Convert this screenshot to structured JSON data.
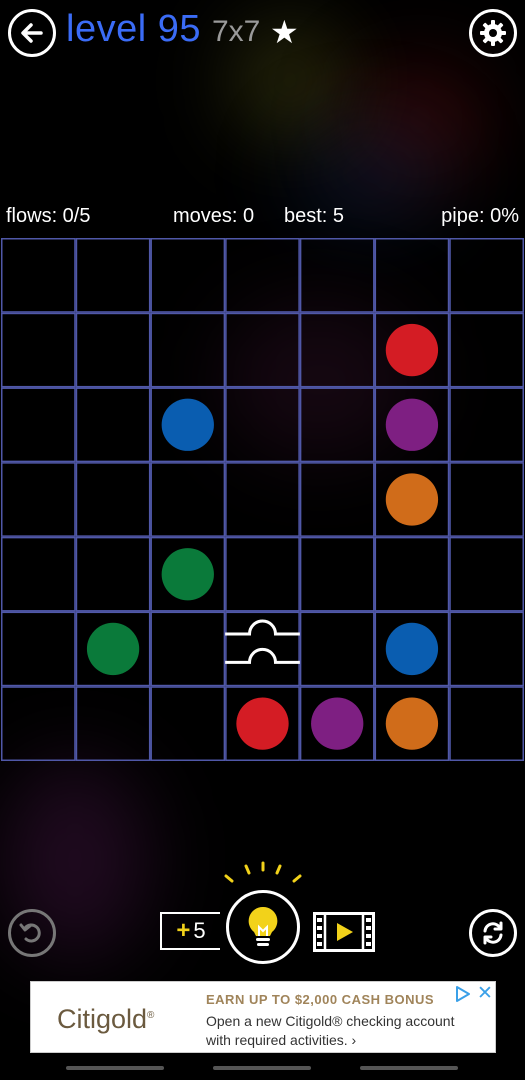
{
  "header": {
    "level_title": "level 95",
    "size_label": "7x7",
    "star": "★"
  },
  "stats": {
    "flows": "flows: 0/5",
    "moves": "moves: 0",
    "best": "best: 5",
    "pipe": "pipe: 0%"
  },
  "board": {
    "rows": 7,
    "cols": 7,
    "grid_color": "#5058a8",
    "dots": [
      {
        "row": 1,
        "col": 5,
        "color": "#d41c24"
      },
      {
        "row": 2,
        "col": 2,
        "color": "#0a5db0"
      },
      {
        "row": 2,
        "col": 5,
        "color": "#7e1f82"
      },
      {
        "row": 3,
        "col": 5,
        "color": "#d06c1a"
      },
      {
        "row": 4,
        "col": 2,
        "color": "#0a7a3a"
      },
      {
        "row": 5,
        "col": 1,
        "color": "#0a7a3a"
      },
      {
        "row": 5,
        "col": 5,
        "color": "#0a5db0"
      },
      {
        "row": 6,
        "col": 3,
        "color": "#d41c24"
      },
      {
        "row": 6,
        "col": 4,
        "color": "#7e1f82"
      },
      {
        "row": 6,
        "col": 5,
        "color": "#d06c1a"
      }
    ],
    "bridges": [
      {
        "row": 5,
        "col": 3
      }
    ]
  },
  "controls": {
    "hints_plus": "+",
    "hints_count": "5"
  },
  "ad": {
    "logo": "Citigold",
    "logo_mark": "®",
    "headline": "EARN UP TO $2,000 CASH BONUS",
    "body": "Open a new Citigold® checking account with required activities. ›",
    "close": "✕"
  },
  "icons": {
    "back": "arrow-left-icon",
    "settings": "gear-icon",
    "undo": "undo-icon",
    "hint": "lightbulb-icon",
    "video": "film-play-icon",
    "reset": "refresh-icon",
    "adchoices": "adchoices-icon"
  }
}
